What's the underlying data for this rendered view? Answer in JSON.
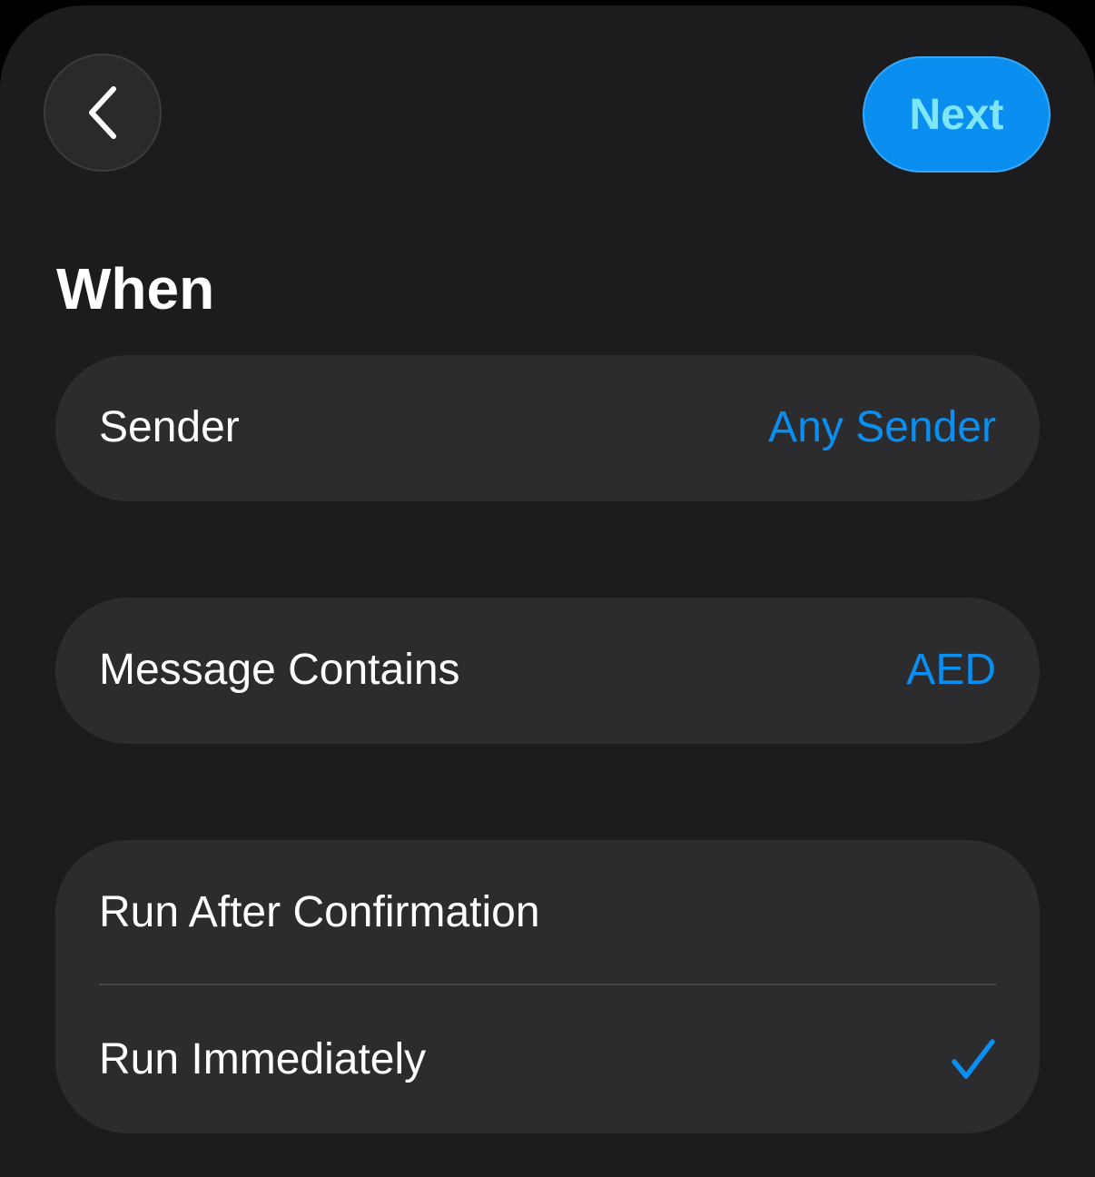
{
  "header": {
    "back_icon": "chevron-left-icon",
    "next_label": "Next"
  },
  "title": "When",
  "conditions": {
    "sender": {
      "label": "Sender",
      "value": "Any Sender"
    },
    "message": {
      "label": "Message Contains",
      "value": "AED"
    }
  },
  "run_options": [
    {
      "label": "Run After Confirmation",
      "selected": false
    },
    {
      "label": "Run Immediately",
      "selected": true
    }
  ],
  "colors": {
    "background": "#1c1c1e",
    "card": "#2c2c2e",
    "accent": "#0a8ff0",
    "next_text": "#7fe6f7"
  },
  "icons": {
    "selected_icon": "checkmark-icon"
  }
}
